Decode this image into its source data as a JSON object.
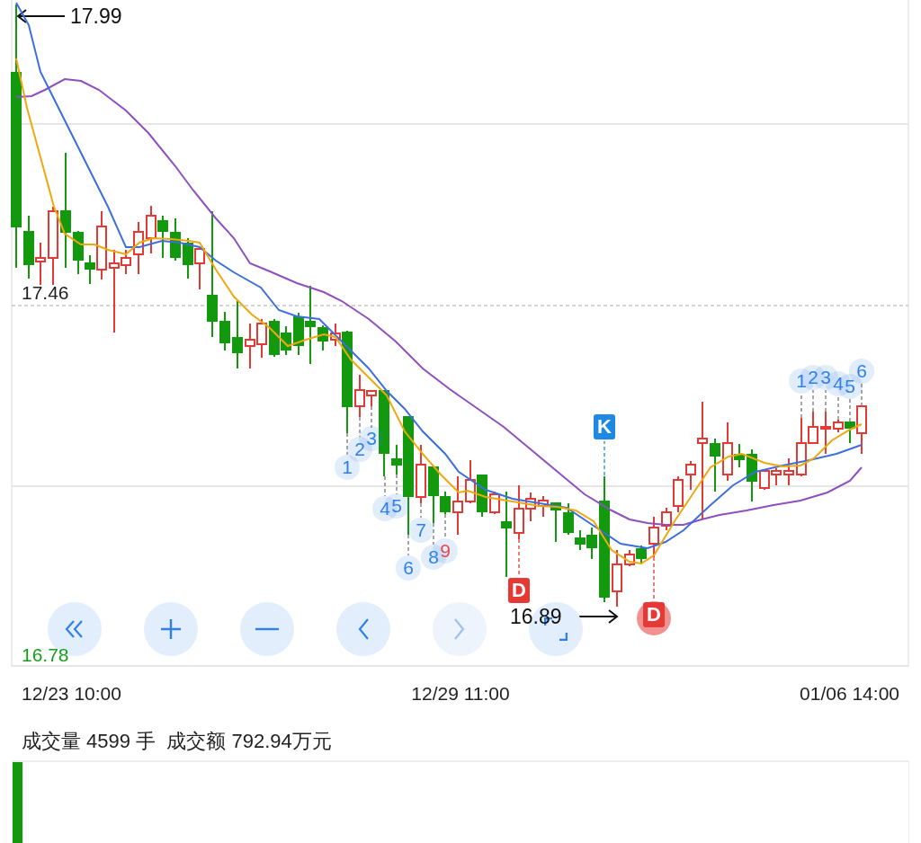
{
  "chart": {
    "price_labels": [
      {
        "text": "17.99",
        "kind": "high"
      },
      {
        "text": "17.46",
        "kind": "reference"
      },
      {
        "text": "16.89",
        "kind": "low"
      },
      {
        "text": "16.78",
        "kind": "bottom"
      }
    ],
    "markers": [
      {
        "label": "1",
        "kind": "number",
        "color": "#2f80ed",
        "highlighted": false
      },
      {
        "label": "2",
        "kind": "number",
        "color": "#2f80ed",
        "highlighted": false
      },
      {
        "label": "3",
        "kind": "number",
        "color": "#2f80ed",
        "highlighted": false
      },
      {
        "label": "4",
        "kind": "number",
        "color": "#2f80ed",
        "highlighted": false
      },
      {
        "label": "5",
        "kind": "number",
        "color": "#2f80ed",
        "highlighted": false
      },
      {
        "label": "6",
        "kind": "number",
        "color": "#2f80ed",
        "highlighted": false
      },
      {
        "label": "7",
        "kind": "number",
        "color": "#2f80ed",
        "highlighted": false
      },
      {
        "label": "8",
        "kind": "number",
        "color": "#2f80ed",
        "highlighted": false
      },
      {
        "label": "9",
        "kind": "number",
        "color": "#e5484d",
        "highlighted": false
      },
      {
        "label": "D",
        "kind": "badge",
        "color": "#e53935",
        "highlighted": false
      },
      {
        "label": "K",
        "kind": "badge",
        "color": "#1e88e5",
        "highlighted": false
      },
      {
        "label": "D",
        "kind": "badge",
        "color": "#e53935",
        "highlighted": true
      },
      {
        "label": "1",
        "kind": "number",
        "color": "#2f80ed",
        "highlighted": false
      },
      {
        "label": "2",
        "kind": "number",
        "color": "#2f80ed",
        "highlighted": false
      },
      {
        "label": "3",
        "kind": "number",
        "color": "#2f80ed",
        "highlighted": false
      },
      {
        "label": "4",
        "kind": "number",
        "color": "#2f80ed",
        "highlighted": false
      },
      {
        "label": "5",
        "kind": "number",
        "color": "#2f80ed",
        "highlighted": false
      },
      {
        "label": "6",
        "kind": "number",
        "color": "#2f80ed",
        "highlighted": false
      }
    ],
    "controls": [
      {
        "kind": "rewind",
        "disabled": false
      },
      {
        "kind": "zoom-in",
        "disabled": false
      },
      {
        "kind": "zoom-out",
        "disabled": false
      },
      {
        "kind": "back",
        "disabled": false
      },
      {
        "kind": "forward",
        "disabled": true
      },
      {
        "kind": "fullscreen",
        "disabled": false
      }
    ]
  },
  "time_labels": [
    "12/23 10:00",
    "12/29 11:00",
    "01/06 14:00"
  ],
  "volume": {
    "summary": "成交量 4599 手  成交额 792.94万元"
  }
}
